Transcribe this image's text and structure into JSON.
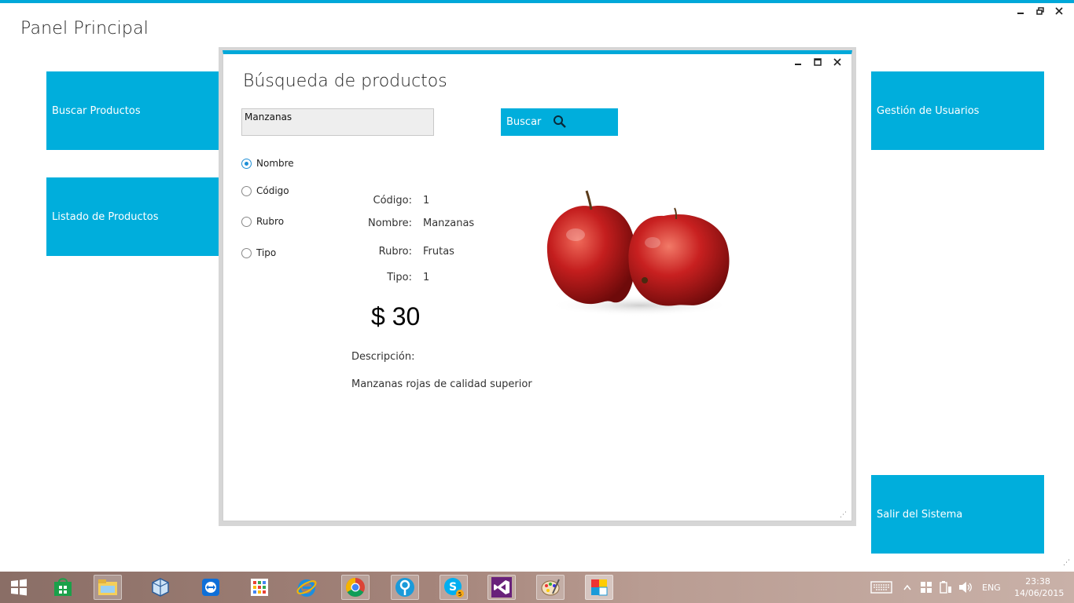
{
  "window": {
    "title": "Panel Principal",
    "controls": {
      "minimize": "‒",
      "restore": "🗗",
      "close": "✕"
    }
  },
  "tiles": {
    "buscar": "Buscar Productos",
    "listado": "Listado de Productos",
    "gestion": "Gestión de Usuarios",
    "salir": "Salir del Sistema"
  },
  "dialog": {
    "title": "Búsqueda de productos",
    "search": {
      "value": "Manzanas",
      "button_label": "Buscar"
    },
    "radios": [
      {
        "label": "Nombre",
        "checked": true
      },
      {
        "label": "Código",
        "checked": false
      },
      {
        "label": "Rubro",
        "checked": false
      },
      {
        "label": "Tipo",
        "checked": false
      }
    ],
    "fields": {
      "codigo_label": "Código:",
      "codigo_value": "1",
      "nombre_label": "Nombre:",
      "nombre_value": "Manzanas",
      "rubro_label": "Rubro:",
      "rubro_value": "Frutas",
      "tipo_label": "Tipo:",
      "tipo_value": "1"
    },
    "price": "$ 30",
    "description_label": "Descripción:",
    "description": "Manzanas rojas de calidad superior"
  },
  "taskbar": {
    "language": "ENG",
    "time": "23:38",
    "date": "14/06/2015",
    "skype_badge": "5"
  },
  "colors": {
    "accent": "#00aedc",
    "topbar": "#00a8d9"
  }
}
